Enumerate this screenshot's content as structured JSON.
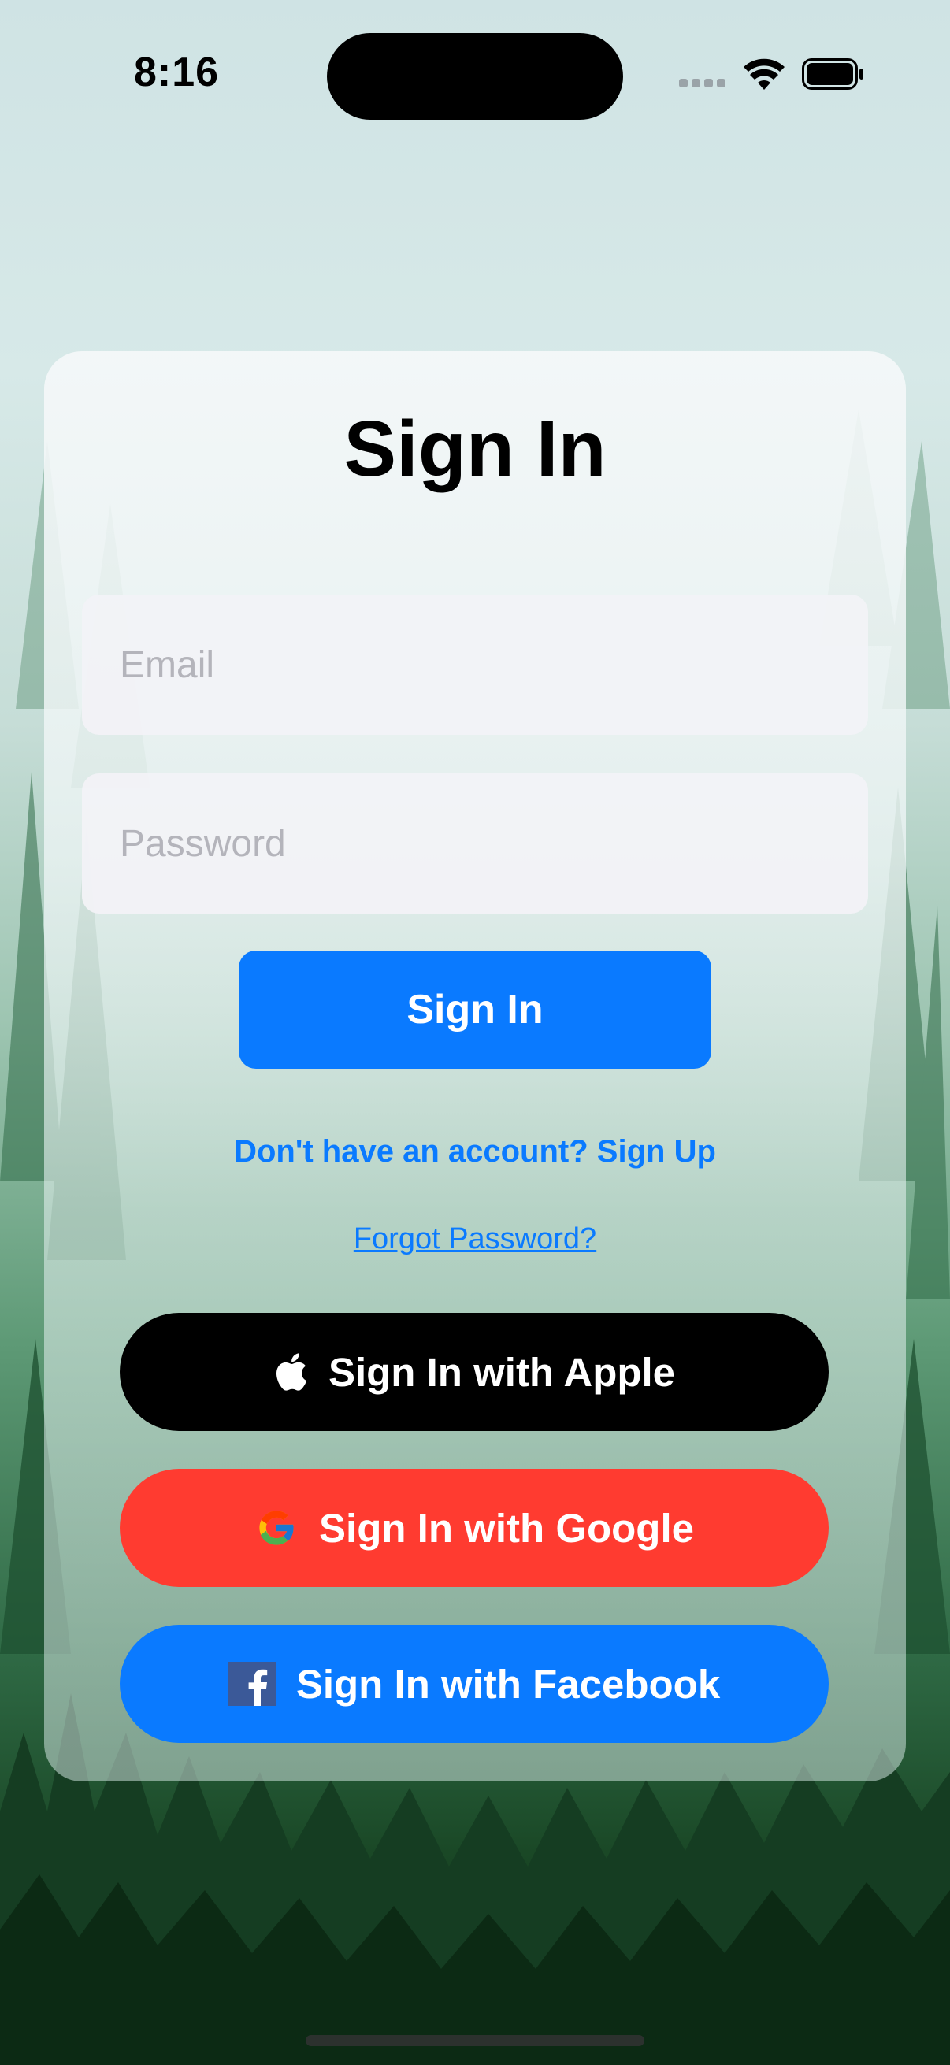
{
  "status_bar": {
    "time": "8:16",
    "icons": [
      "signal-icon",
      "wifi-icon",
      "battery-icon"
    ]
  },
  "card": {
    "title": "Sign In",
    "email": {
      "placeholder": "Email",
      "value": ""
    },
    "password": {
      "placeholder": "Password",
      "value": ""
    },
    "sign_in_button": "Sign In",
    "signup_link": "Don't have an account? Sign Up",
    "forgot_link": "Forgot Password?",
    "social": {
      "apple": {
        "label": "Sign In with Apple",
        "icon": "apple-icon",
        "color": "#000000"
      },
      "google": {
        "label": "Sign In with Google",
        "icon": "google-icon",
        "color": "#FF3B30"
      },
      "facebook": {
        "label": "Sign In with Facebook",
        "icon": "facebook-icon",
        "color": "#0A7AFF"
      }
    }
  },
  "colors": {
    "accent": "#0A7AFF",
    "field_background": "#F2F2F7",
    "placeholder": "#B4B4BB"
  }
}
